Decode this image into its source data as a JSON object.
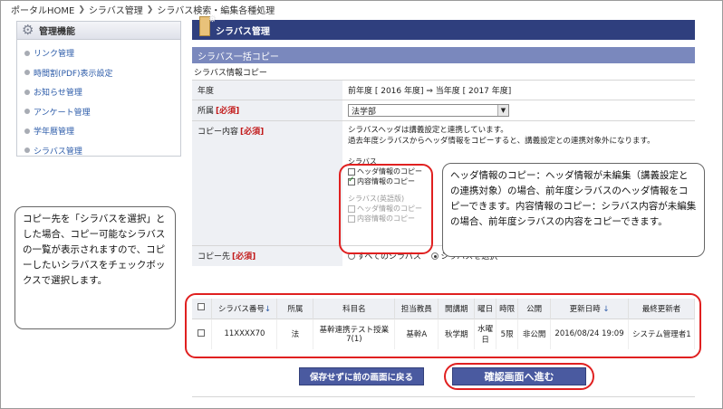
{
  "breadcrumb": [
    "ポータルHOME",
    "シラバス管理",
    "シラバス検索・編集各種処理"
  ],
  "sidebar": {
    "title": "管理機能",
    "items": [
      {
        "label": "リンク管理"
      },
      {
        "label": "時間割(PDF)表示設定"
      },
      {
        "label": "お知らせ管理"
      },
      {
        "label": "アンケート管理"
      },
      {
        "label": "学年暦管理"
      },
      {
        "label": "シラバス管理"
      }
    ]
  },
  "page_title": "シラバス管理",
  "section_title": "シラバス一括コピー",
  "subsection_title": "シラバス情報コピー",
  "form": {
    "year_label": "年度",
    "year_value": "前年度 [ 2016 年度] ⇒ 当年度 [ 2017 年度]",
    "affiliation_label": "所属",
    "required_mark": "[必須]",
    "affiliation_value": "法学部",
    "copy_label": "コピー内容",
    "copy_note_1": "シラバスヘッダは講義設定と連携しています。",
    "copy_note_2": "過去年度シラバスからヘッダ情報をコピーすると、講義設定との連携対象外になります。",
    "syllabus_group": "シラバス",
    "header_copy": "ヘッダ情報のコピー",
    "content_copy": "内容情報のコピー",
    "syllabus_en_group": "シラバス(英語版)",
    "header_copy_en": "ヘッダ情報のコピー",
    "content_copy_en": "内容情報のコピー",
    "dest_label": "コピー先",
    "dest_all": "すべてのシラバス",
    "dest_select": "シラバスを選択"
  },
  "callouts": {
    "left": "コピー先を「シラバスを選択」とした場合、コピー可能なシラバスの一覧が表示されますので、コピーしたいシラバスをチェックボックスで選択します。",
    "right": "ヘッダ情報のコピー：ヘッダ情報が未編集（講義設定との連携対象）の場合、前年度シラバスのヘッダ情報をコピーできます。内容情報のコピー：シラバス内容が未編集の場合、前年度シラバスの内容をコピーできます。"
  },
  "table": {
    "headers": [
      "シラバス番号",
      "所属",
      "科目名",
      "担当教員",
      "開講期",
      "曜日",
      "時限",
      "公開",
      "更新日時",
      "最終更新者"
    ],
    "sort_mark": "↓",
    "rows": [
      {
        "code": "11XXXX70",
        "affiliation": "法",
        "subject": "基幹連携テスト授業7(1)",
        "teacher": "基幹A",
        "term": "秋学期",
        "day": "水曜日",
        "period": "5限",
        "published": "非公開",
        "updated": "2016/08/24 19:09",
        "updater": "システム管理者1"
      }
    ]
  },
  "buttons": {
    "back": "保存せずに前の画面に戻る",
    "confirm": "確認画面へ進む"
  },
  "colors": {
    "title_bar": "#2f3f7e",
    "section_bar": "#7a88bd",
    "highlight": "#e02020",
    "button": "#4a5aa0"
  }
}
